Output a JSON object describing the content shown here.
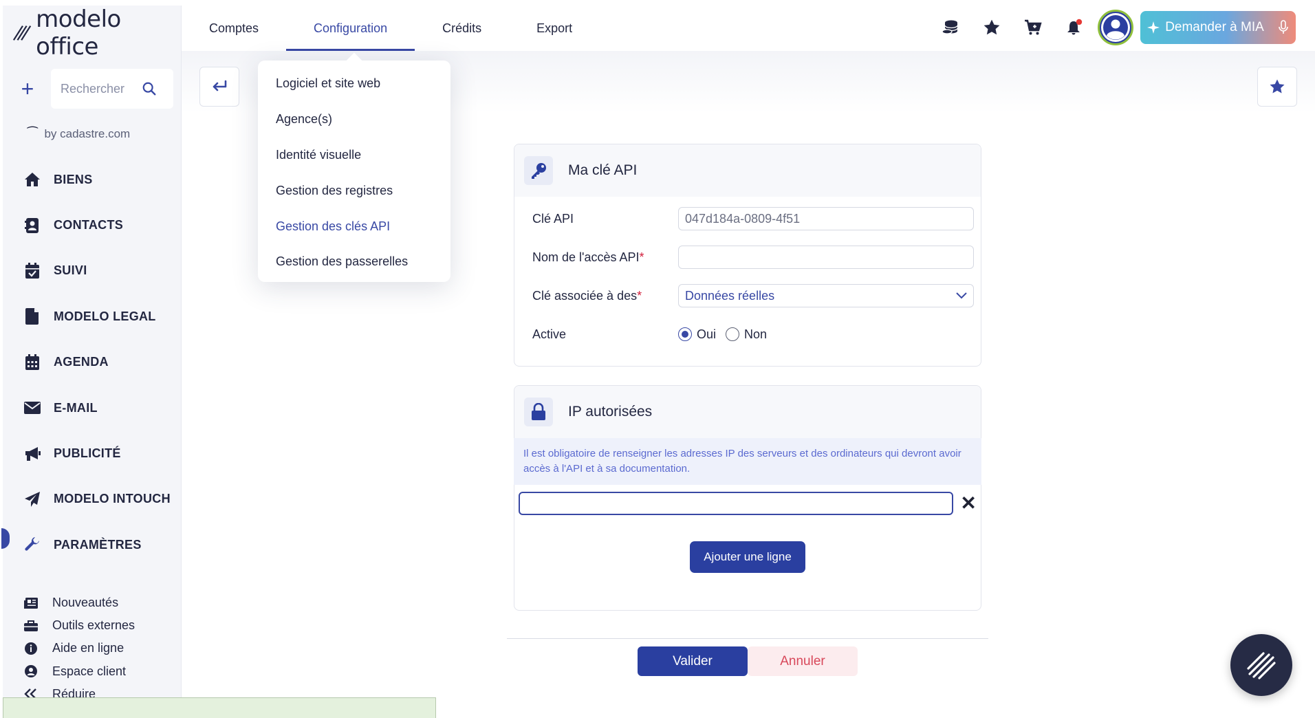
{
  "app": {
    "logo_text": "modelo office"
  },
  "sidebar": {
    "search_placeholder": "Rechercher",
    "by_line": "by cadastre.com",
    "items": [
      {
        "label": "BIENS",
        "icon": "home-icon"
      },
      {
        "label": "CONTACTS",
        "icon": "contact-card-icon"
      },
      {
        "label": "SUIVI",
        "icon": "calendar-check-icon"
      },
      {
        "label": "MODELO LEGAL",
        "icon": "document-icon"
      },
      {
        "label": "AGENDA",
        "icon": "calendar-icon"
      },
      {
        "label": "E-MAIL",
        "icon": "envelope-icon"
      },
      {
        "label": "PUBLICITÉ",
        "icon": "megaphone-icon"
      },
      {
        "label": "MODELO INTOUCH",
        "icon": "paper-plane-icon"
      },
      {
        "label": "PARAMÈTRES",
        "icon": "wrench-icon",
        "active": true
      }
    ],
    "bottom_links": [
      {
        "label": "Nouveautés",
        "icon": "newspaper-icon"
      },
      {
        "label": "Outils externes",
        "icon": "toolbox-icon"
      },
      {
        "label": "Aide en ligne",
        "icon": "info-icon"
      },
      {
        "label": "Espace client",
        "icon": "user-circle-icon"
      },
      {
        "label": "Réduire",
        "icon": "double-chevron-left-icon"
      }
    ]
  },
  "topnav": {
    "tabs": [
      {
        "label": "Comptes"
      },
      {
        "label": "Configuration",
        "active": true
      },
      {
        "label": "Crédits"
      },
      {
        "label": "Export"
      }
    ],
    "mia_button": "Demander à MIA"
  },
  "dropdown": {
    "items": [
      {
        "label": "Logiciel et site web"
      },
      {
        "label": "Agence(s)"
      },
      {
        "label": "Identité visuelle"
      },
      {
        "label": "Gestion des registres"
      },
      {
        "label": "Gestion des clés API",
        "active": true
      },
      {
        "label": "Gestion des passerelles"
      }
    ]
  },
  "api_card": {
    "title": "Ma clé API",
    "fields": {
      "key_label": "Clé API",
      "key_value": "047d184a-0809-4f51",
      "name_label": "Nom de l'accès API",
      "name_value": "",
      "assoc_label": "Clé associée à des",
      "assoc_value": "Données réelles",
      "active_label": "Active",
      "active_yes": "Oui",
      "active_no": "Non",
      "active_selected": "Oui"
    },
    "required_mark": "*"
  },
  "ip_card": {
    "title": "IP autorisées",
    "note": "Il est obligatoire de renseigner les adresses IP des serveurs et des ordinateurs qui devront avoir accès à l'API et à sa documentation.",
    "ip_value": "",
    "add_button": "Ajouter une ligne"
  },
  "footer_actions": {
    "validate": "Valider",
    "cancel": "Annuler"
  },
  "colors": {
    "primary": "#2a3fa0",
    "accent": "#3848a4",
    "danger": "#d21f3c",
    "notification": "#e53935",
    "avatar_ring": "#8fbf3b"
  }
}
